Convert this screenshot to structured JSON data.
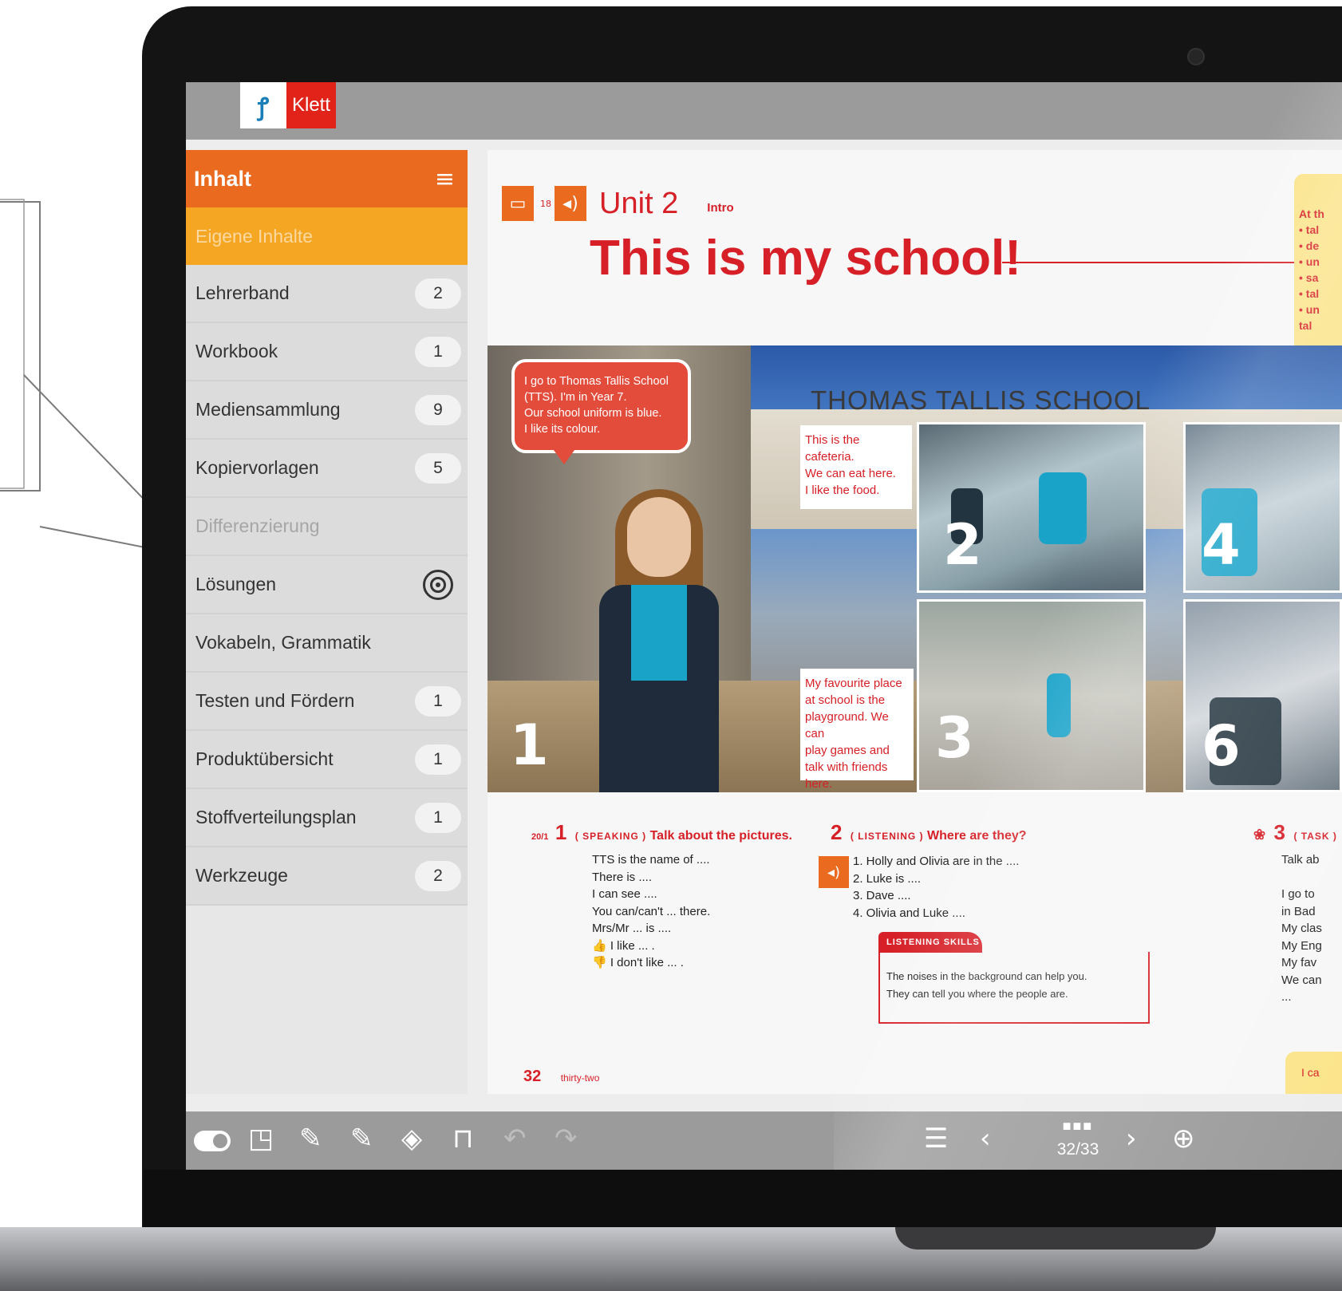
{
  "brand": {
    "logo_text": "Klett",
    "logo_mark": "Klett logo mark"
  },
  "sidebar": {
    "header_title": "Inhalt",
    "header_icon": "collapse-menu-icon",
    "own_content_label": "Eigene Inhalte",
    "items": [
      {
        "label": "Lehrerband",
        "count": "2"
      },
      {
        "label": "Workbook",
        "count": "1"
      },
      {
        "label": "Mediensammlung",
        "count": "9"
      },
      {
        "label": "Kopiervorlagen",
        "count": "5"
      },
      {
        "label": "Differenzierung",
        "count": "",
        "disabled": true
      },
      {
        "label": "Lösungen",
        "icon": "target-icon"
      },
      {
        "label": "Vokabeln, Grammatik",
        "count": ""
      },
      {
        "label": "Testen und Fördern",
        "count": "1"
      },
      {
        "label": "Produktübersicht",
        "count": "1"
      },
      {
        "label": "Stoffverteilungsplan",
        "count": "1"
      },
      {
        "label": "Werkzeuge",
        "count": "2"
      }
    ]
  },
  "page": {
    "unit_label": "Unit 2",
    "unit_ref": "18",
    "intro_label": "Intro",
    "title": "This is my school!",
    "goals_lines": [
      "At th",
      "• tal",
      "• de",
      "• un",
      "• sa",
      "• tal",
      "• un",
      "  tal"
    ],
    "school_sign": "THOMAS TALLIS SCHOOL",
    "speech_bubble": [
      "I go to Thomas Tallis School",
      "(TTS). I'm in Year 7.",
      "Our school uniform is blue.",
      "I like its colour."
    ],
    "note_cafeteria": [
      "This is the",
      "cafeteria.",
      "We can eat here.",
      "I like the food."
    ],
    "note_playground": [
      "My favourite place",
      "at school is the",
      "playground. We can",
      "play games and",
      "talk with friends",
      "here."
    ],
    "photo_numbers": [
      "1",
      "2",
      "3",
      "4",
      "6"
    ],
    "exercise1": {
      "ref": "20/1",
      "number": "1",
      "tag": "( SPEAKING )",
      "title": "Talk about the pictures.",
      "lines": [
        "TTS is the name of ....",
        "There is ....",
        "I can see ....",
        "You can/can't ... there.",
        "Mrs/Mr ... is ....",
        "👍 I like ... .",
        "👎 I don't like ... ."
      ]
    },
    "exercise2": {
      "number": "2",
      "tag": "( LISTENING )",
      "title": "Where are they?",
      "lines": [
        "1. Holly and Olivia are in the ....",
        "2. Luke is ....",
        "3. Dave ....",
        "4. Olivia and Luke ...."
      ],
      "skills_label": "LISTENING SKILLS",
      "skills_text": [
        "The noises in the background can help you.",
        "They can tell you where the people are."
      ]
    },
    "exercise3": {
      "number": "3",
      "tag": "( TASK )",
      "lines": [
        "Talk ab",
        "",
        "I go to",
        "in Bad",
        "My clas",
        "My Eng",
        "My fav",
        "We can",
        "..."
      ]
    },
    "page_number": "32",
    "page_word": "thirty-two",
    "ican": "I ca"
  },
  "toolbar": {
    "pager_text": "32/33",
    "icons": [
      "toggle-icon",
      "page-icon",
      "pen-icon",
      "highlighter-icon",
      "eraser-icon",
      "bookmark-icon",
      "undo-icon",
      "redo-icon",
      "list-icon",
      "prev-icon",
      "grid-icon",
      "next-icon",
      "zoom-in-icon"
    ]
  },
  "colors": {
    "accent_orange": "#ea6a1f",
    "accent_yellow": "#f5a623",
    "title_red": "#d61f26",
    "toolbar_gray": "#9b9b9b"
  }
}
